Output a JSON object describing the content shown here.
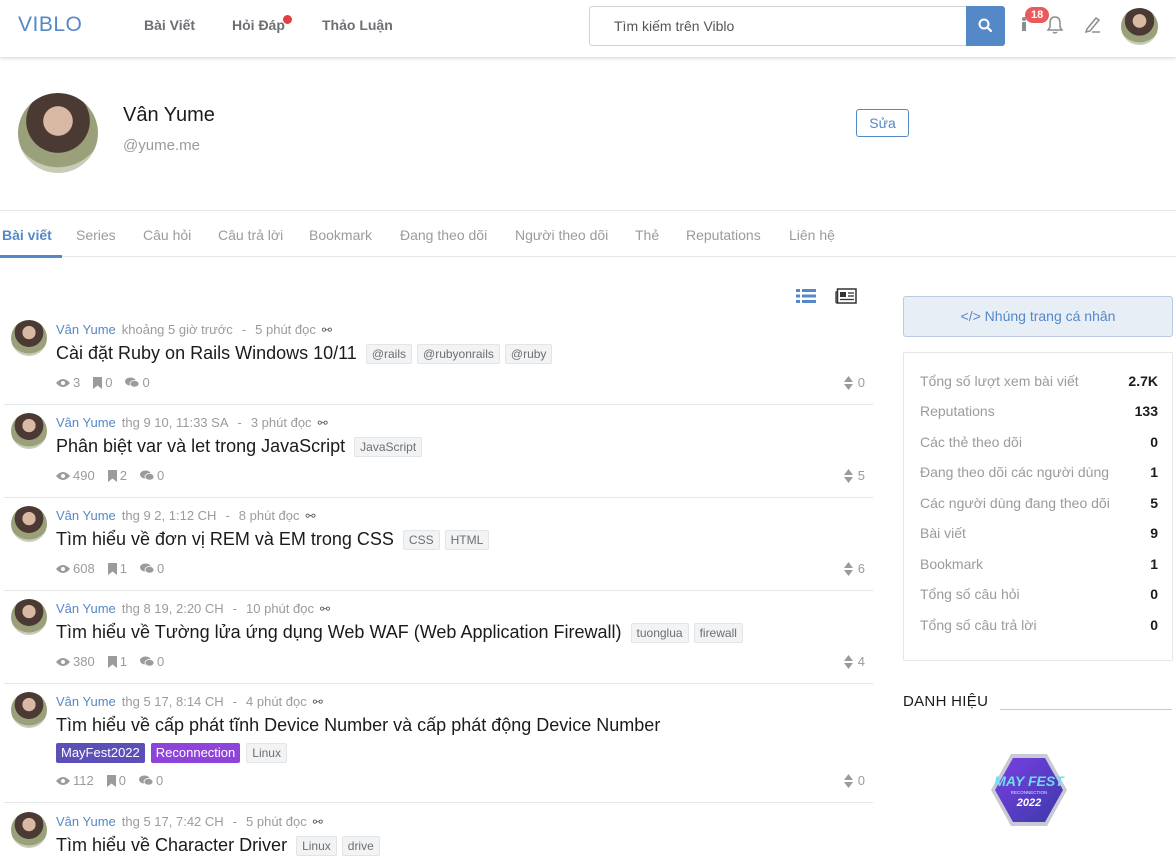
{
  "header": {
    "logo": "VIBLO",
    "nav": [
      "Bài Viết",
      "Hỏi Đáp",
      "Thảo Luận"
    ],
    "search_placeholder": "Tìm kiếm trên Viblo",
    "notification_count": "18"
  },
  "profile": {
    "name": "Vân Yume",
    "handle": "@yume.me",
    "edit_label": "Sửa"
  },
  "tabs": [
    "Bài viết",
    "Series",
    "Câu hỏi",
    "Câu trả lời",
    "Bookmark",
    "Đang theo dõi",
    "Người theo dõi",
    "Thẻ",
    "Reputations",
    "Liên hệ"
  ],
  "posts": [
    {
      "author": "Vân Yume",
      "time": "khoảng 5 giờ trước",
      "read": "5 phút đọc",
      "title": "Cài đặt Ruby on Rails Windows 10/11",
      "tags": [
        "@rails",
        "@rubyonrails",
        "@ruby"
      ],
      "views": "3",
      "bookmarks": "0",
      "comments": "0",
      "score": "0"
    },
    {
      "author": "Vân Yume",
      "time": "thg 9 10, 11:33 SA",
      "read": "3 phút đọc",
      "title": "Phân biệt var và let trong JavaScript",
      "tags": [
        "JavaScript"
      ],
      "views": "490",
      "bookmarks": "2",
      "comments": "0",
      "score": "5"
    },
    {
      "author": "Vân Yume",
      "time": "thg 9 2, 1:12 CH",
      "read": "8 phút đọc",
      "title": "Tìm hiểu về đơn vị REM và EM trong CSS",
      "tags": [
        "CSS",
        "HTML"
      ],
      "views": "608",
      "bookmarks": "1",
      "comments": "0",
      "score": "6"
    },
    {
      "author": "Vân Yume",
      "time": "thg 8 19, 2:20 CH",
      "read": "10 phút đọc",
      "title": "Tìm hiểu về Tường lửa ứng dụng Web WAF (Web Application Firewall)",
      "tags": [
        "tuonglua",
        "firewall"
      ],
      "views": "380",
      "bookmarks": "1",
      "comments": "0",
      "score": "4"
    },
    {
      "author": "Vân Yume",
      "time": "thg 5 17, 8:14 CH",
      "read": "4 phút đọc",
      "title": "Tìm hiểu về cấp phát tĩnh Device Number và cấp phát động Device Number",
      "tags": [
        "MayFest2022",
        "Reconnection",
        "Linux"
      ],
      "views": "112",
      "bookmarks": "0",
      "comments": "0",
      "score": "0"
    },
    {
      "author": "Vân Yume",
      "time": "thg 5 17, 7:42 CH",
      "read": "5 phút đọc",
      "title": "Tìm hiểu về Character Driver",
      "tags": [
        "Linux",
        "drive"
      ]
    }
  ],
  "sidebar": {
    "embed_label": "</> Nhúng trang cá nhân",
    "stats": [
      {
        "label": "Tổng số lượt xem bài viết",
        "value": "2.7K"
      },
      {
        "label": "Reputations",
        "value": "133"
      },
      {
        "label": "Các thẻ theo dõi",
        "value": "0"
      },
      {
        "label": "Đang theo dõi các người dùng",
        "value": "1"
      },
      {
        "label": "Các người dùng đang theo dõi",
        "value": "5"
      },
      {
        "label": "Bài viết",
        "value": "9"
      },
      {
        "label": "Bookmark",
        "value": "1"
      },
      {
        "label": "Tổng số câu hỏi",
        "value": "0"
      },
      {
        "label": "Tổng số câu trả lời",
        "value": "0"
      }
    ],
    "title_section": "DANH HIỆU",
    "badge_line1": "MAY FEST",
    "badge_line2": "RECONNECTION",
    "badge_year": "2022"
  },
  "colors": {
    "accent": "#5488c7",
    "mayfest": "#5b4fb8",
    "reconnection": "#8e44d9"
  }
}
